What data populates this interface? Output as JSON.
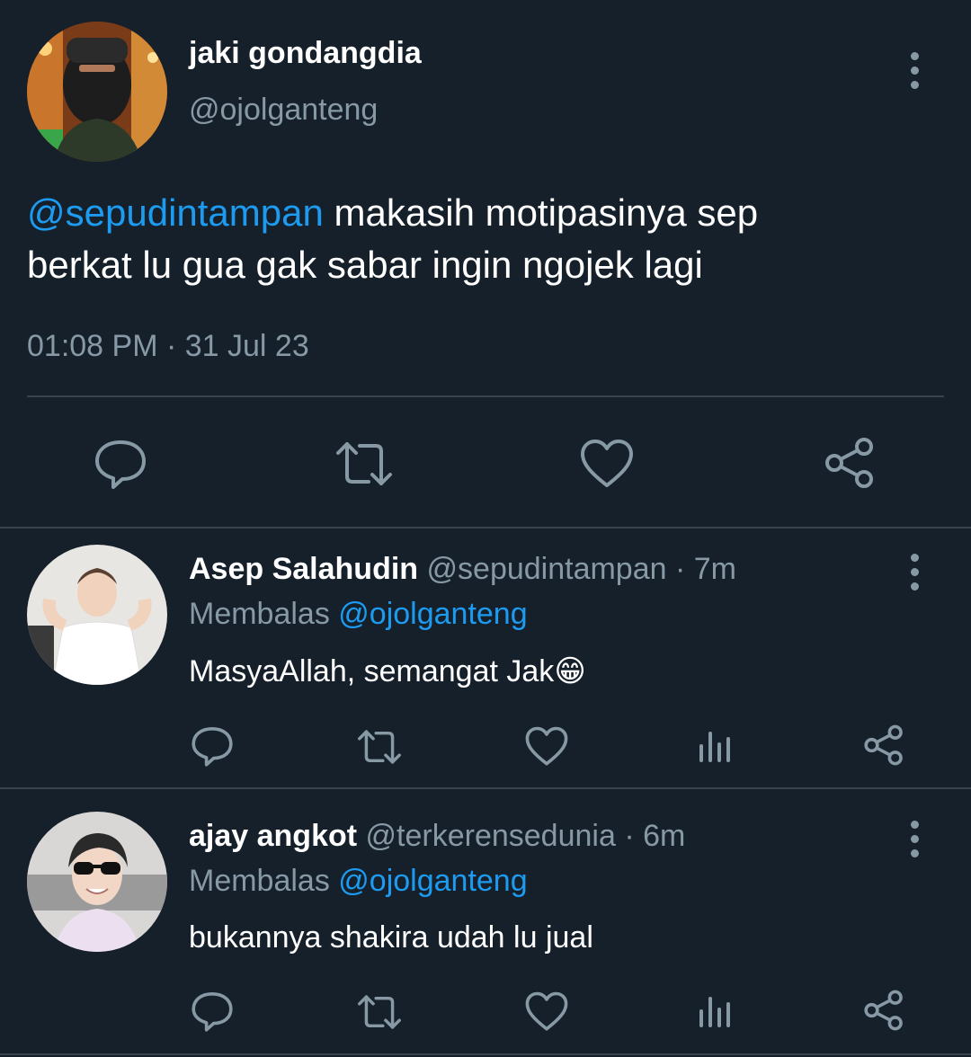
{
  "main_tweet": {
    "name": "jaki gondangdia",
    "handle": "@ojolganteng",
    "mention": "@sepudintampan",
    "text_line1": " makasih motipasinya sep",
    "text_line2": "berkat lu gua gak sabar ingin ngojek lagi",
    "timestamp": "01:08 PM · 31 Jul 23",
    "icons": [
      "reply-icon",
      "retweet-icon",
      "like-icon",
      "share-icon"
    ]
  },
  "replies": [
    {
      "name": "Asep Salahudin",
      "handle": "@sepudintampan",
      "time": "· 7m",
      "replying_prefix": "Membalas ",
      "replying_to": "@ojolganteng",
      "text": "MasyaAllah, semangat Jak",
      "emoji": "😁",
      "icons": [
        "reply-icon",
        "retweet-icon",
        "like-icon",
        "analytics-icon",
        "share-icon"
      ]
    },
    {
      "name": "ajay angkot",
      "handle": "@terkerensedunia",
      "time": "· 6m",
      "replying_prefix": "Membalas ",
      "replying_to": "@ojolganteng",
      "text": "bukannya shakira udah lu jual",
      "icons": [
        "reply-icon",
        "retweet-icon",
        "like-icon",
        "analytics-icon",
        "share-icon"
      ]
    }
  ],
  "colors": {
    "background": "#15202b",
    "divider": "#38444d",
    "muted": "#8899a6",
    "link": "#1d9bf0",
    "text": "#ffffff"
  }
}
